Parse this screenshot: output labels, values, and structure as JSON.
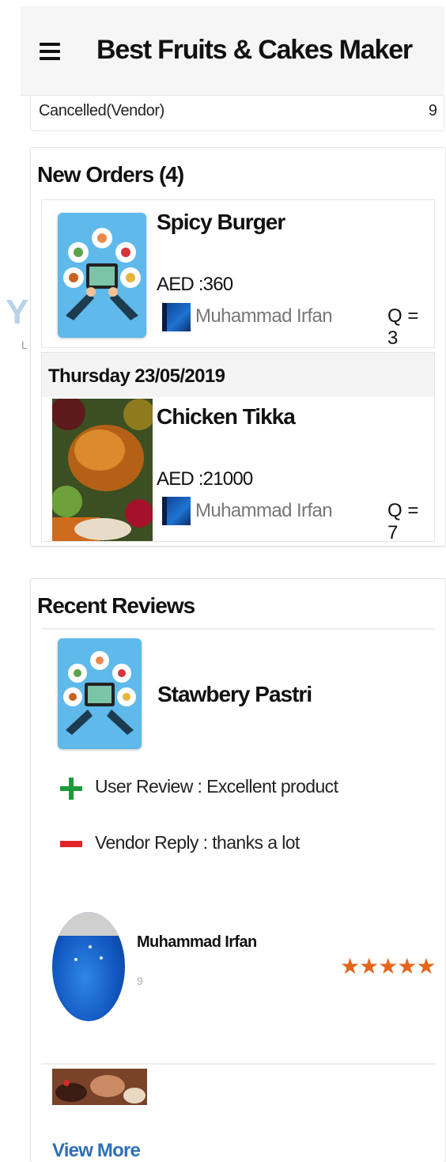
{
  "app_bar": {
    "title": "Best Fruits & Cakes Maker",
    "menu_icon": "hamburger-menu-icon"
  },
  "status_row": {
    "label": "Cancelled(Vendor)",
    "count": "9"
  },
  "watermark": {
    "letter": "Y",
    "sub": "L"
  },
  "new_orders": {
    "title": "New Orders (4)",
    "orders": [
      {
        "name": "Spicy Burger",
        "price": "AED :360",
        "vendor": "Muhammad Irfan",
        "qty": "Q = 3",
        "image": "app-illustration-image"
      },
      {
        "date": "Thursday 23/05/2019",
        "name": "Chicken Tikka",
        "price": "AED :21000",
        "vendor": "Muhammad Irfan",
        "qty": "Q = 7",
        "image": "roast-chicken-image"
      }
    ]
  },
  "recent_reviews": {
    "title": "Recent Reviews",
    "reviews": [
      {
        "product": "Stawbery Pastri",
        "user_review": "User Review : Excellent product",
        "vendor_reply": "Vendor Reply : thanks a lot",
        "reviewer": "Muhammad Irfan",
        "reviewer_sub": "9",
        "rating": 5,
        "stars_text": "★★★★★"
      }
    ],
    "view_more": "View More"
  },
  "colors": {
    "accent_link": "#2e6fb7",
    "star": "#e4661c",
    "plus": "#1f9a3b",
    "minus": "#e2232a"
  }
}
